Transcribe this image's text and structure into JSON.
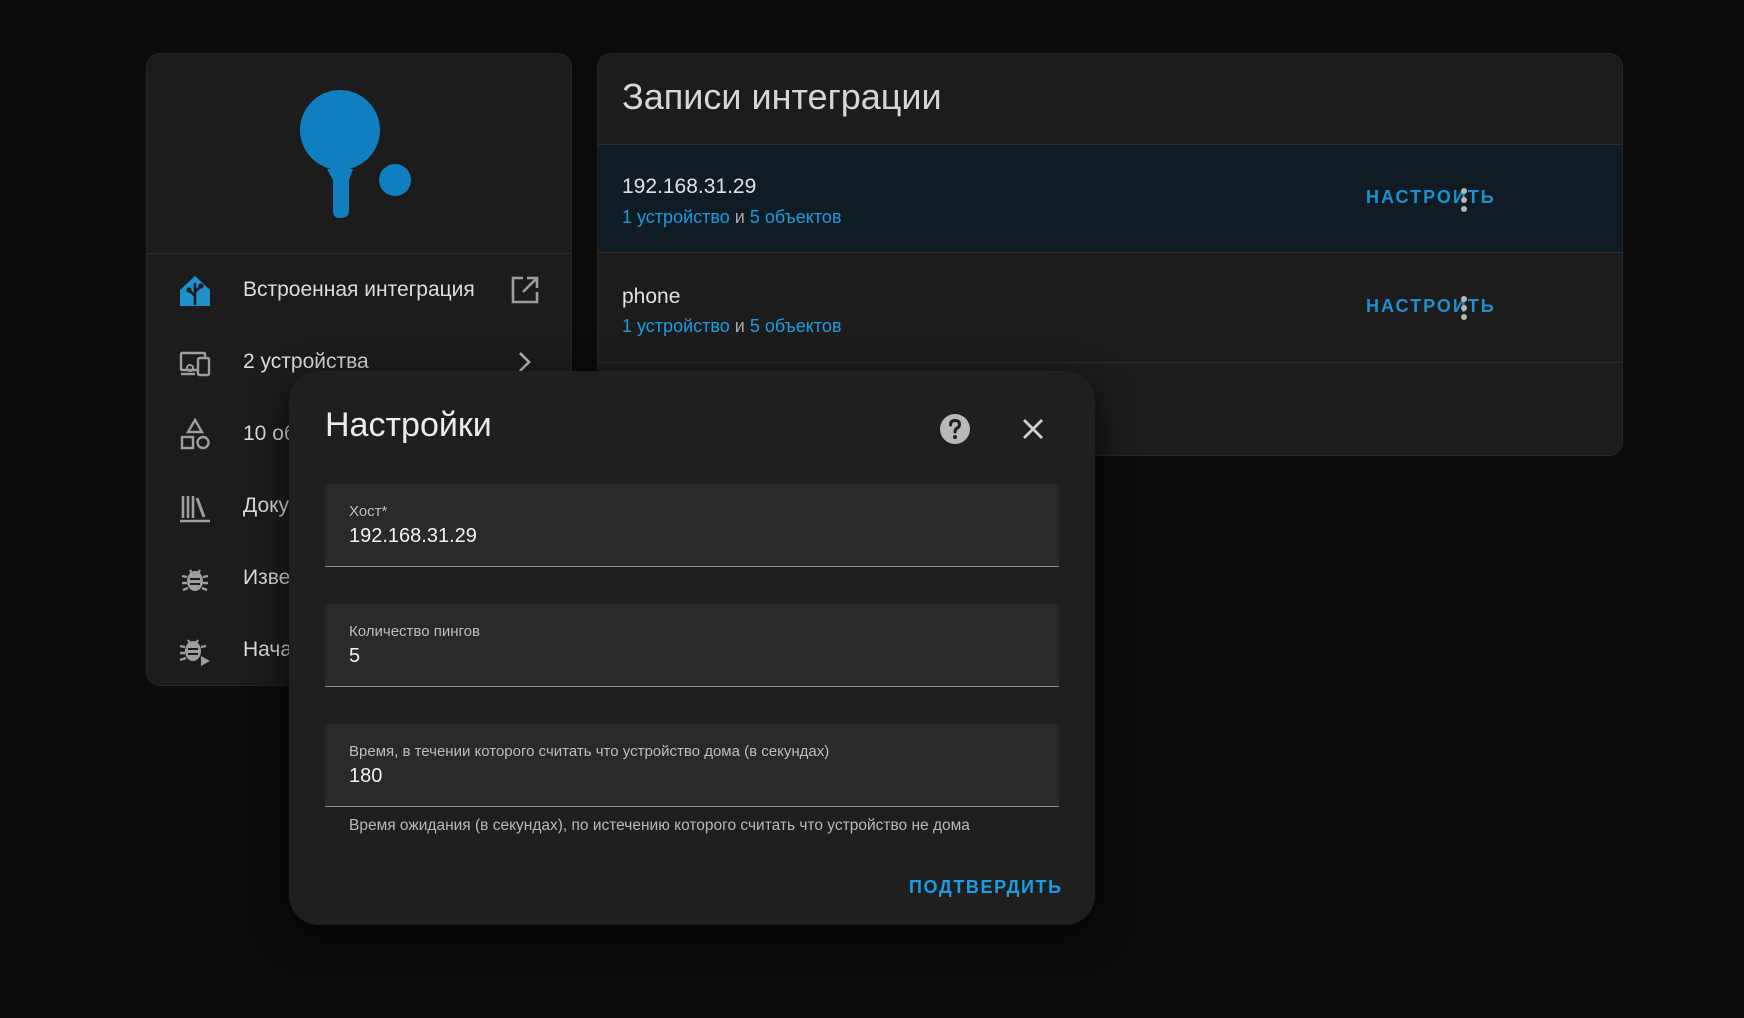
{
  "info_card": {
    "rows": [
      {
        "label": "Встроенная интеграция",
        "icon": "home-assistant-icon"
      },
      {
        "label": "2 устройства",
        "icon": "devices-icon"
      },
      {
        "label": "10 объектов",
        "icon": "shapes-icon"
      },
      {
        "label": "Документация",
        "icon": "bookshelf-icon"
      },
      {
        "label": "Известные проблемы",
        "icon": "bug-icon"
      },
      {
        "label": "Начать отладку",
        "icon": "bug-play-icon"
      }
    ]
  },
  "entries_card": {
    "title": "Записи интеграции",
    "entries": [
      {
        "name": "192.168.31.29",
        "devices_link": "1 устройство",
        "joiner": " и ",
        "entities_link": "5 объектов",
        "configure_label": "Настроить"
      },
      {
        "name": "phone",
        "devices_link": "1 устройство",
        "joiner": " и ",
        "entities_link": "5 объектов",
        "configure_label": "Настроить"
      }
    ]
  },
  "dialog": {
    "title": "Настройки",
    "fields": [
      {
        "label": "Хост*",
        "value": "192.168.31.29"
      },
      {
        "label": "Количество пингов",
        "value": "5"
      },
      {
        "label": "Время, в течении которого считать что устройство дома (в секундах)",
        "value": "180"
      }
    ],
    "helper_text": "Время ожидания (в секундах), по истечению которого считать что устройство не дома",
    "submit_label": "ПОДТВЕРДИТЬ"
  },
  "colors": {
    "accent": "#1f9be0",
    "logo": "#0f7fc0",
    "background": "#0b0b0b",
    "card": "#1c1c1c"
  }
}
